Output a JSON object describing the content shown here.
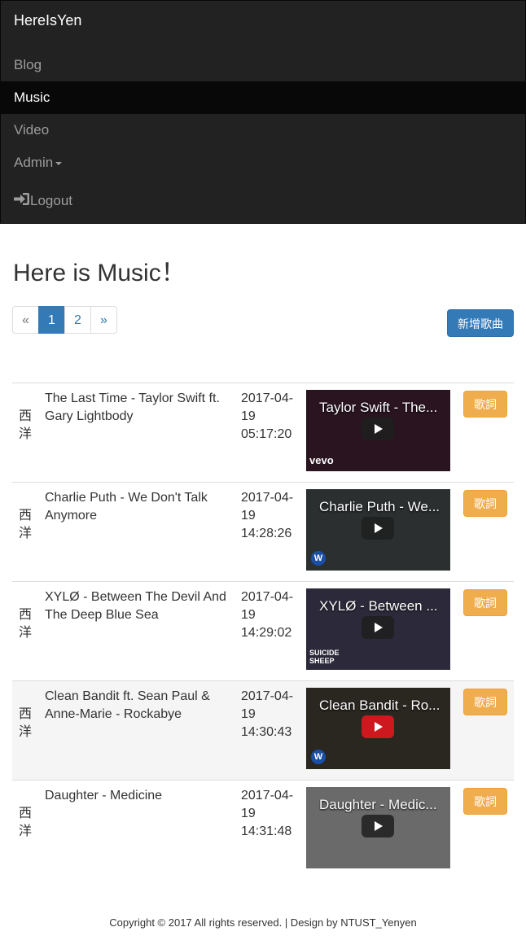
{
  "navbar": {
    "brand": "HereIsYen",
    "items": [
      {
        "label": "Blog",
        "active": false
      },
      {
        "label": "Music",
        "active": true
      },
      {
        "label": "Video",
        "active": false
      },
      {
        "label": "Admin",
        "active": false
      }
    ],
    "logout": "Logout"
  },
  "main": {
    "title": "Here is Music！",
    "pagination": [
      "«",
      "1",
      "2",
      "»"
    ],
    "add_button": "新增歌曲"
  },
  "songs": [
    {
      "category": "西洋",
      "title": "The Last Time - Taylor Swift ft. Gary Lightbody",
      "date": "2017-04-19",
      "time": "05:17:20",
      "thumb_title": "Taylor Swift - The...",
      "thumb_mark": "vevo",
      "lyric": "歌詞"
    },
    {
      "category": "西洋",
      "title": "Charlie Puth - We Don't Talk Anymore",
      "date": "2017-04-19",
      "time": "14:28:26",
      "thumb_title": "Charlie Puth - We...",
      "thumb_mark": "W",
      "lyric": "歌詞"
    },
    {
      "category": "西洋",
      "title": "XYLØ - Between The Devil And The Deep Blue Sea",
      "date": "2017-04-19",
      "time": "14:29:02",
      "thumb_title": "XYLØ - Between ...",
      "thumb_mark": "SUICIDE SHEEP",
      "lyric": "歌詞"
    },
    {
      "category": "西洋",
      "title": "Clean Bandit ft. Sean Paul & Anne-Marie - Rockabye",
      "date": "2017-04-19",
      "time": "14:30:43",
      "thumb_title": "Clean Bandit - Ro...",
      "thumb_mark": "W",
      "lyric": "歌詞"
    },
    {
      "category": "西洋",
      "title": "Daughter - Medicine",
      "date": "2017-04-19",
      "time": "14:31:48",
      "thumb_title": "Daughter - Medic...",
      "thumb_mark": "",
      "lyric": "歌詞"
    }
  ],
  "footer": "Copyright © 2017 All rights reserved. | Design by NTUST_Yenyen"
}
